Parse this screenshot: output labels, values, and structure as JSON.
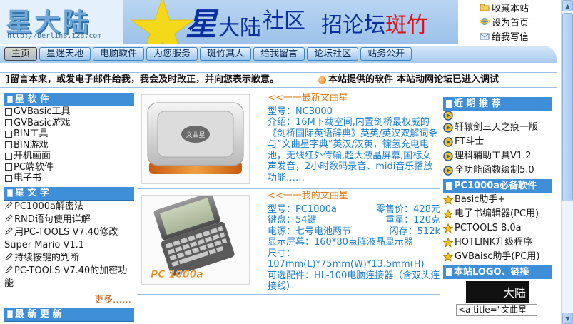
{
  "logo": {
    "text": "星大陆",
    "url": "http://berlin8.126.com"
  },
  "banner": {
    "xing": "星",
    "dalu": "大陆",
    "shequ": "社区",
    "recruit_prefix": "招论坛",
    "recruit_red": "斑竹"
  },
  "header_links": [
    {
      "label": "收藏本站",
      "icon": "folder-icon"
    },
    {
      "label": "设为首页",
      "icon": "ie-globe-icon"
    },
    {
      "label": "给我写信",
      "icon": "mail-icon"
    }
  ],
  "nav": [
    {
      "label": "主页",
      "active": true
    },
    {
      "label": "星迷天地"
    },
    {
      "label": "电脑软件"
    },
    {
      "label": "为您服务"
    },
    {
      "label": "斑竹其人"
    },
    {
      "label": "给我留言"
    },
    {
      "label": "论坛社区"
    },
    {
      "label": "站务公开"
    }
  ],
  "marquee": {
    "part1": "]留言本来，或发电子邮件给我，我会及时改正，并向您表示歉意。",
    "part2": "本站提供的软件",
    "part3": "本站动网论坛已进入调试"
  },
  "left": {
    "software": {
      "title": "星 软 件",
      "items": [
        "GVBasic工具",
        "GVBasic游戏",
        "BIN工具",
        "BIN游戏",
        "开机画面",
        "PC端软件",
        "电子书"
      ]
    },
    "articles": {
      "title": "星 文 学",
      "items": [
        "PC1000a解密法",
        "RND语句使用详解",
        "用PC-TOOLS V7.40修改",
        "Super Mario V1.1",
        "持续按键的判断",
        "PC-TOOLS V7.40的加密功能"
      ],
      "more": "更多……"
    },
    "updates": {
      "title": "最 新 更 新"
    }
  },
  "products": [
    {
      "title": "<<一一最新文曲星",
      "lines": [
        "型号：NC3000",
        "介绍：16M下载空间,内置剑桥最权威的《剑桥国际英语辞典》英英/英汉双解词条与“文曲星字典”英汉/汉英，镍氢充电电池，无线红外传输,超大液晶屏幕,国标女声发音，2小时数码录音、midi音乐播放功能……"
      ],
      "img_label": "文曲星"
    },
    {
      "title": "<<一一我的文曲星",
      "model": "型号：PC1000a",
      "price": "零售价：428元",
      "keys": "键盘：54键",
      "weight": "重量：120克",
      "power": "电源：七号电池两节",
      "flash": "闪存：512k",
      "display": "显示屏幕：160*80点阵液晶显示器",
      "size": "尺寸：107mm(L)*75mm(W)*13.5mm(H)",
      "accessory": "可选配件：HL-100电脑连接器（含双头连接线）",
      "img_label": "PC 1000a"
    }
  ],
  "right": {
    "recommend": {
      "title": "近 期 推 荐",
      "items": [
        "",
        "轩辕剑三天之痕一版",
        "FT斗士",
        "理科辅助工具V1.2",
        "全功能函数绘制5.0"
      ]
    },
    "essentials": {
      "title": "PC1000a必备软件",
      "items": [
        "Basic助手+",
        "电子书编辑器(PC用)",
        "PCTOOLS 8.0a",
        "HOTLINK升级程序",
        "GVBaisc助手(PC用)"
      ]
    },
    "logo_link": {
      "title": "本站LOGO、链接",
      "logo_text": "大陆",
      "code_text": "<a title=\"文曲星"
    }
  }
}
